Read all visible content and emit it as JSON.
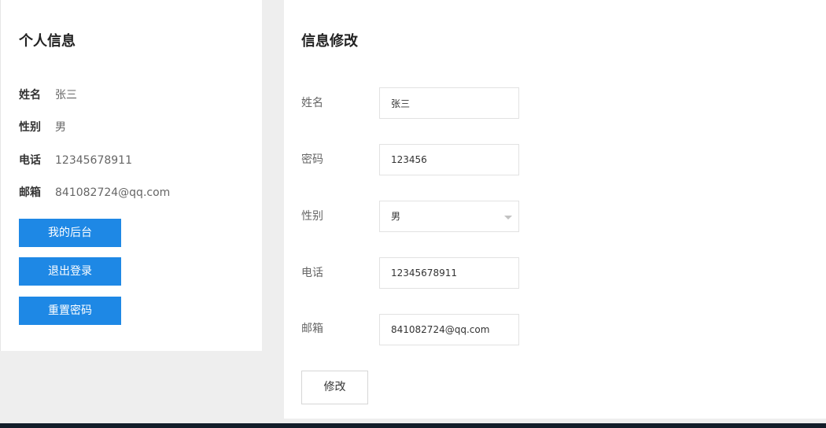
{
  "profile": {
    "title": "个人信息",
    "fields": [
      {
        "label": "姓名",
        "value": "张三"
      },
      {
        "label": "性别",
        "value": "男"
      },
      {
        "label": "电话",
        "value": "12345678911"
      },
      {
        "label": "邮箱",
        "value": "841082724@qq.com"
      }
    ],
    "buttons": {
      "dashboard": "我的后台",
      "logout": "退出登录",
      "reset_password": "重置密码"
    }
  },
  "edit_form": {
    "title": "信息修改",
    "name": {
      "label": "姓名",
      "value": "张三"
    },
    "password": {
      "label": "密码",
      "value": "123456"
    },
    "gender": {
      "label": "性别",
      "value": "男"
    },
    "phone": {
      "label": "电话",
      "value": "12345678911"
    },
    "email": {
      "label": "邮箱",
      "value": "841082724@qq.com"
    },
    "submit_label": "修改"
  },
  "colors": {
    "primary_button": "#1e88e5",
    "background": "#eeeeee",
    "footer_bar": "#121d29"
  }
}
